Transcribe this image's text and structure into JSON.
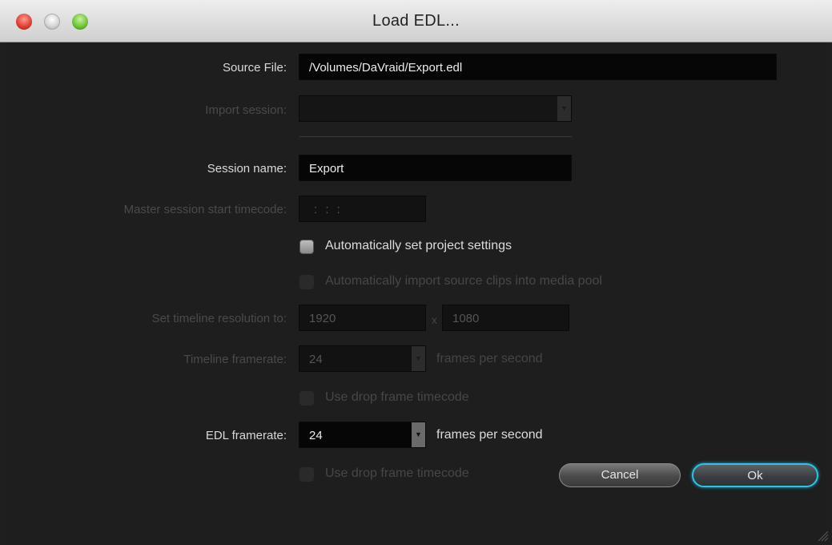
{
  "window": {
    "title": "Load EDL...",
    "traffic_lights": [
      "close-light",
      "minimize-light",
      "zoom-light"
    ]
  },
  "form": {
    "source_file": {
      "label": "Source File:",
      "value": "/Volumes/DaVraid/Export.edl"
    },
    "import_session": {
      "label": "Import session:",
      "value": "",
      "enabled": false
    },
    "session_name": {
      "label": "Session name:",
      "value": "Export"
    },
    "master_timecode": {
      "label": "Master session start timecode:",
      "value": ": : :",
      "enabled": false
    },
    "auto_project_settings": {
      "label": "Automatically set project settings",
      "checked": false
    },
    "auto_import_clips": {
      "label": "Automatically import source clips into media pool",
      "checked": false,
      "enabled": false
    },
    "timeline_resolution": {
      "label": "Set timeline resolution to:",
      "width": "1920",
      "separator": "x",
      "height": "1080",
      "enabled": false
    },
    "timeline_framerate": {
      "label": "Timeline framerate:",
      "value": "24",
      "suffix": "frames per second",
      "enabled": false
    },
    "timeline_drop_frame": {
      "label": "Use drop frame timecode",
      "checked": false,
      "enabled": false
    },
    "edl_framerate": {
      "label": "EDL framerate:",
      "value": "24",
      "suffix": "frames per second"
    },
    "edl_drop_frame": {
      "label": "Use drop frame timecode",
      "checked": false,
      "enabled": false
    }
  },
  "buttons": {
    "cancel": "Cancel",
    "ok": "Ok"
  },
  "colors": {
    "background": "#1e1e1e",
    "accent": "#2ec3e6",
    "disabled_text": "#4a4a4a"
  }
}
